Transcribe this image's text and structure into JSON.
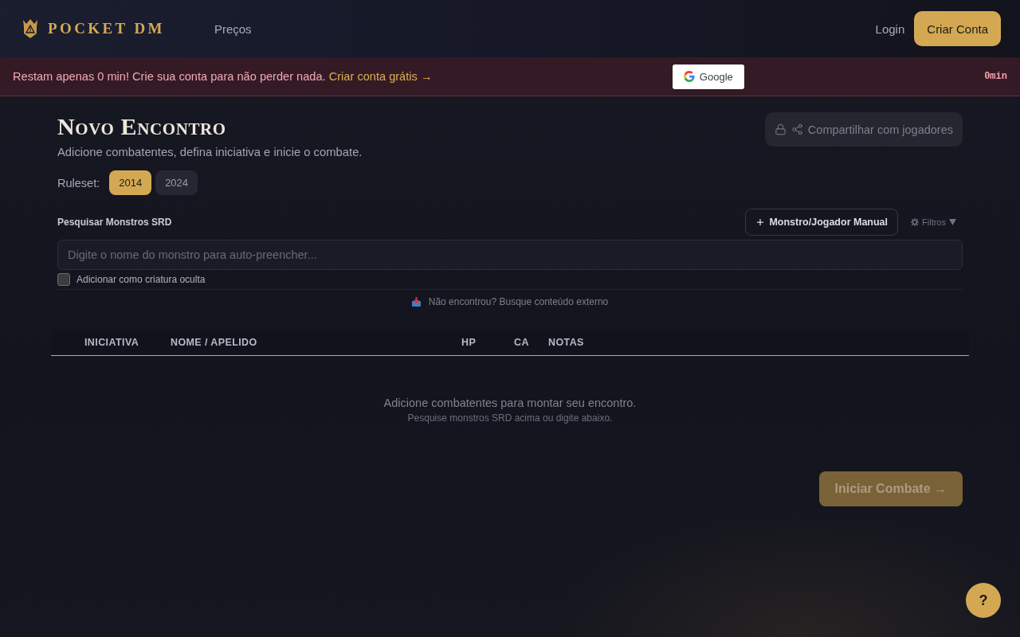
{
  "header": {
    "logo": "POCKET DM",
    "nav": [
      {
        "label": "Preços"
      }
    ],
    "login": "Login",
    "signup": "Criar Conta"
  },
  "banner": {
    "message": "Restam apenas 0 min! Crie sua conta para não perder nada.",
    "link": "Criar conta grátis →",
    "google_button": "Google",
    "timer": "0min"
  },
  "page": {
    "title": "Novo Encontro",
    "subtitle": "Adicione combatentes, defina iniciativa e inicie o combate.",
    "share_button": {
      "label": "Compartilhar com jogadores",
      "disabled": true
    },
    "ruleset": {
      "label": "Ruleset:",
      "options": [
        {
          "label": "2014",
          "selected": true
        },
        {
          "label": "2024",
          "selected": false
        }
      ]
    }
  },
  "search": {
    "label": "Pesquisar Monstros SRD",
    "manual_button": "Monstro/Jogador Manual",
    "filters": "Filtros",
    "placeholder": "Digite o nome do monstro para auto-preencher...",
    "hidden_checkbox": {
      "label": "Adicionar como criatura oculta",
      "checked": false
    },
    "external_link": "Não encontrou? Busque conteúdo externo"
  },
  "table": {
    "columns": [
      "INICIATIVA",
      "NOME / APELIDO",
      "HP",
      "CA",
      "NOTAS"
    ],
    "empty_title": "Adicione combatentes para montar seu encontro.",
    "empty_hint": "Pesquise monstros SRD acima ou digite abaixo."
  },
  "start_button": {
    "label": "Iniciar Combate →",
    "disabled": true
  },
  "help_button": "?"
}
